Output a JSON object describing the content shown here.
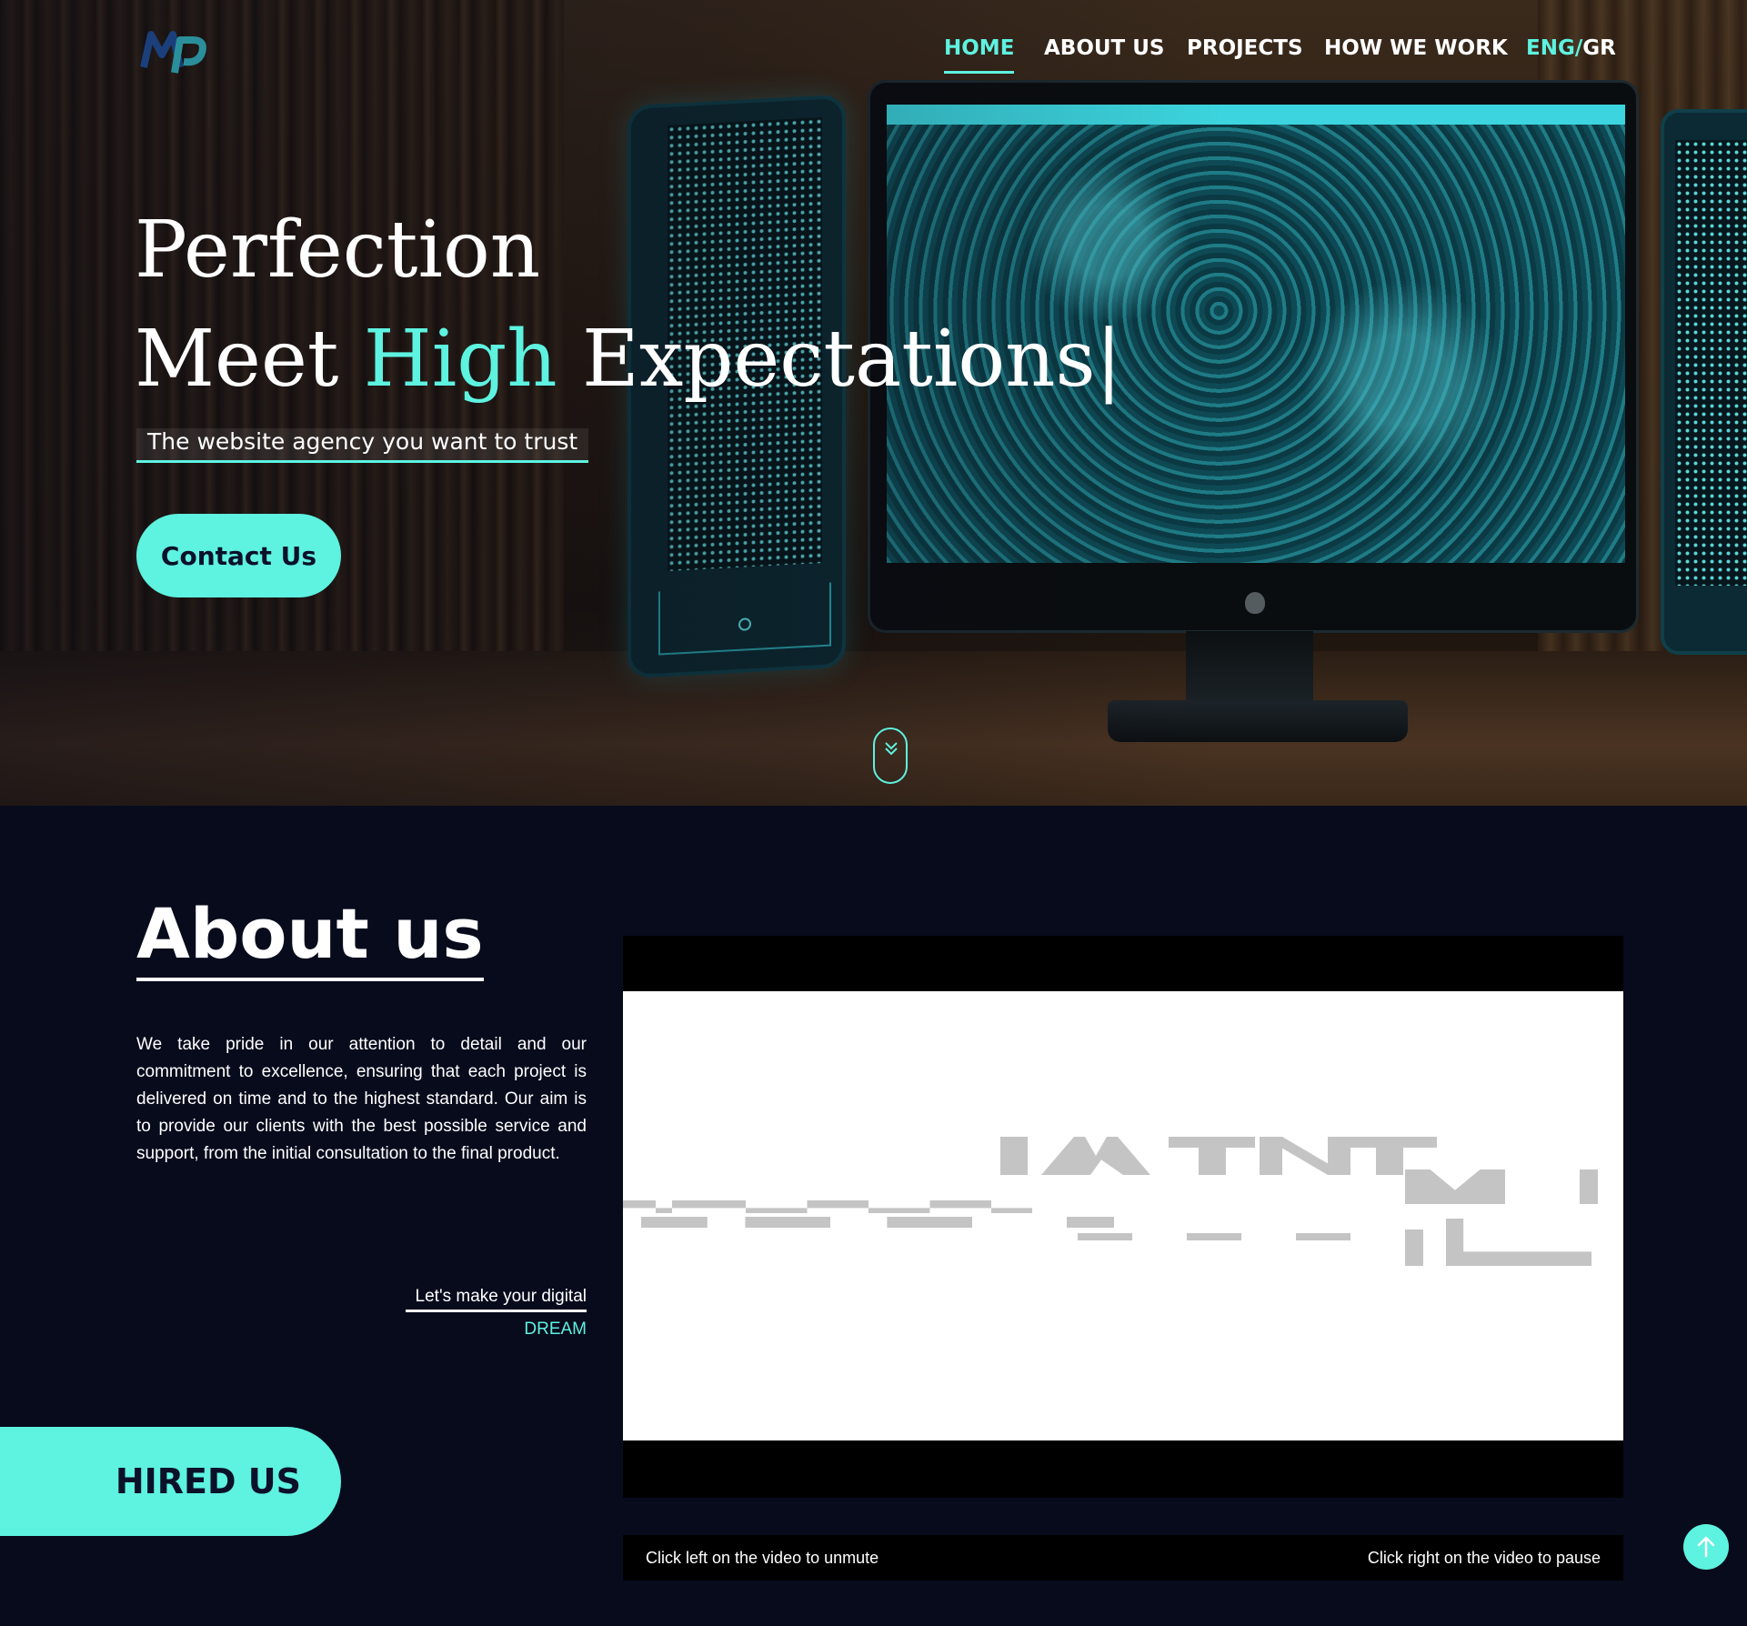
{
  "nav": {
    "items": [
      {
        "label": "HOME",
        "active": true
      },
      {
        "label": "ABOUT US",
        "active": false
      },
      {
        "label": "PROJECTS",
        "active": false
      },
      {
        "label": "HOW WE WORK",
        "active": false
      }
    ],
    "lang_en": "ENG/",
    "lang_gr": "GR"
  },
  "logo": {
    "icon": "mp-logo-icon"
  },
  "hero": {
    "line1": "Perfection",
    "line2_part1": "Meet ",
    "line2_highlight": "High",
    "line2_part2": " Expectations|",
    "tagline": "The website agency you want to trust",
    "contact_label": "Contact Us",
    "scroll_icon": "chevron-down-icon"
  },
  "about": {
    "title": "About us",
    "text": "We take pride in our attention to detail and our commitment to excellence, ensuring that each project is delivered on time and to the highest standard. Our aim is to provide our clients with the best possible service and support, from the initial consultation to the final product.",
    "dream_line1": "Let's make your digital",
    "dream_line2": "DREAM",
    "hired_label": "HIRED US"
  },
  "video": {
    "hint_left": "Click left on the video to unmute",
    "hint_right": "Click right on the video to pause"
  },
  "scroll_top": {
    "icon": "arrow-up-icon"
  },
  "colors": {
    "accent": "#5ef2e0",
    "background": "#070b1c",
    "button_text": "#0a1128"
  }
}
